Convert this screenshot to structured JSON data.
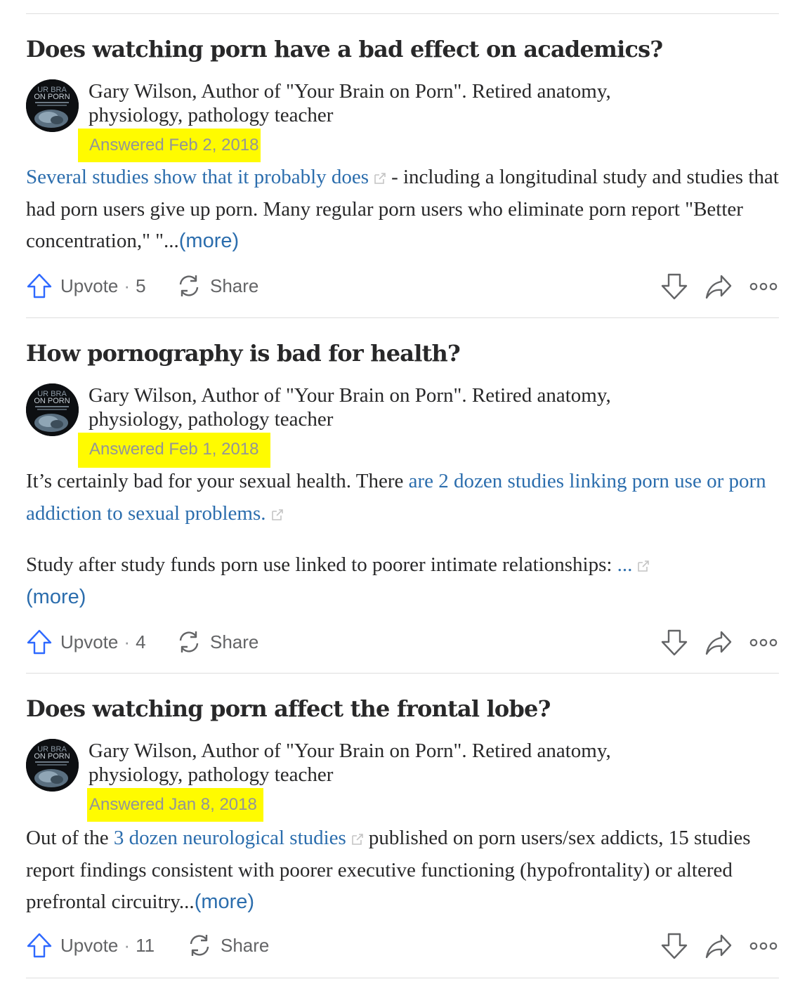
{
  "feed": {
    "answers": [
      {
        "question": "Does watching porn have a bad effect on academics?",
        "author_credential_line1": "Gary Wilson, Author of \"Your Brain on Porn\". Retired anatomy,",
        "author_credential_line2": "physiology, pathology teacher",
        "answered_label": "Answered Feb 2, 2018",
        "body": {
          "link_text": "Several studies show that it probably does",
          "text_after_link": "- including a longitudinal study and studies that had porn users give up porn. Many regular porn users who eliminate porn report \"Better concentration,\" \"...",
          "more_label": "(more)"
        },
        "upvote_label": "Upvote",
        "upvote_count": "5",
        "share_label": "Share"
      },
      {
        "question": "How pornography is bad for health?",
        "author_credential_line1": "Gary Wilson, Author of \"Your Brain on Porn\". Retired anatomy,",
        "author_credential_line2": "physiology, pathology teacher",
        "answered_label": "Answered Feb 1, 2018",
        "body": {
          "text_before_link": "It’s certainly bad for your sexual health. There ",
          "link_text": "are 2 dozen studies linking porn use or porn addiction to sexual problems.",
          "paragraph2_text": "Study after study funds porn use linked to poorer intimate relationships: ",
          "ellipsis_link": "...",
          "more_label": "(more)"
        },
        "upvote_label": "Upvote",
        "upvote_count": "4",
        "share_label": "Share"
      },
      {
        "question": "Does watching porn affect the frontal lobe?",
        "author_credential_line1": "Gary Wilson, Author of \"Your Brain on Porn\". Retired anatomy,",
        "author_credential_line2": "physiology, pathology teacher",
        "answered_label": "Answered Jan 8, 2018",
        "body": {
          "text_before_link": "Out of the ",
          "link_text": "3 dozen neurological studies",
          "text_after_link": "published on porn users/sex addicts, 15 studies report findings consistent with poorer executive functioning (hypofrontality) or altered prefrontal circuitry...",
          "more_label": "(more)"
        },
        "upvote_label": "Upvote",
        "upvote_count": "11",
        "share_label": "Share"
      }
    ]
  },
  "avatar_text": {
    "line1": "UR BRA",
    "line2": "ON PORN"
  },
  "icons": {
    "upvote": "upvote-arrow-icon",
    "share": "share-cycle-icon",
    "downvote": "downvote-arrow-icon",
    "reshare": "reshare-arrow-icon",
    "overflow": "more-options-icon",
    "external": "external-link-icon"
  },
  "colors": {
    "text": "#282829",
    "link": "#2b6dad",
    "meta": "#939598",
    "highlight": "#fffb00",
    "upvote_icon": "#2e69ff",
    "action_icon": "#636466",
    "divider": "#dedede"
  }
}
